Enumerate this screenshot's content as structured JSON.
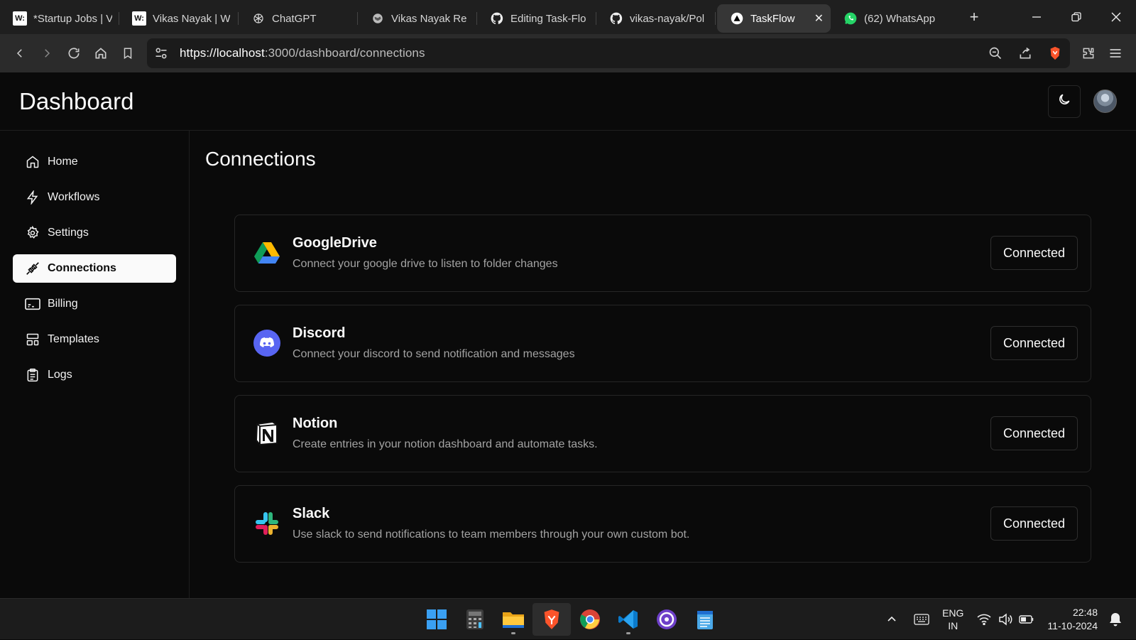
{
  "browser": {
    "tabs": [
      {
        "title": "*Startup Jobs | V",
        "favicon": "w-icon"
      },
      {
        "title": "Vikas Nayak | W",
        "favicon": "w-icon"
      },
      {
        "title": "ChatGPT",
        "favicon": "openai-icon"
      },
      {
        "title": "Vikas Nayak Re",
        "favicon": "globe-icon"
      },
      {
        "title": "Editing Task-Flo",
        "favicon": "github-icon"
      },
      {
        "title": "vikas-nayak/Pol",
        "favicon": "github-icon"
      },
      {
        "title": "TaskFlow",
        "favicon": "vercel-icon",
        "active": true
      },
      {
        "title": "(62) WhatsApp",
        "favicon": "whatsapp-icon"
      }
    ],
    "favicon_letter": "W:",
    "url_host": "https://localhost",
    "url_path": ":3000/dashboard/connections"
  },
  "app": {
    "title": "Dashboard",
    "sidebar": {
      "items": [
        {
          "label": "Home",
          "icon": "home-icon"
        },
        {
          "label": "Workflows",
          "icon": "lightning-icon"
        },
        {
          "label": "Settings",
          "icon": "gear-icon"
        },
        {
          "label": "Connections",
          "icon": "plug-icon",
          "active": true
        },
        {
          "label": "Billing",
          "icon": "billing-icon"
        },
        {
          "label": "Templates",
          "icon": "templates-icon"
        },
        {
          "label": "Logs",
          "icon": "clipboard-icon"
        }
      ]
    },
    "page_title": "Connections",
    "connections": [
      {
        "name": "GoogleDrive",
        "description": "Connect your google drive to listen to folder changes",
        "status": "Connected",
        "icon": "google-drive-icon"
      },
      {
        "name": "Discord",
        "description": "Connect your discord to send notification and messages",
        "status": "Connected",
        "icon": "discord-icon"
      },
      {
        "name": "Notion",
        "description": "Create entries in your notion dashboard and automate tasks.",
        "status": "Connected",
        "icon": "notion-icon"
      },
      {
        "name": "Slack",
        "description": "Use slack to send notifications to team members through your own custom bot.",
        "status": "Connected",
        "icon": "slack-icon"
      }
    ],
    "colors": {
      "background": "#0a0a0a",
      "active_nav": "#fafafa",
      "border": "#262626",
      "muted_text": "#a3a3a3",
      "discord": "#5865f2"
    }
  },
  "taskbar": {
    "language": "ENG",
    "region": "IN",
    "time": "22:48",
    "date": "11-10-2024"
  }
}
